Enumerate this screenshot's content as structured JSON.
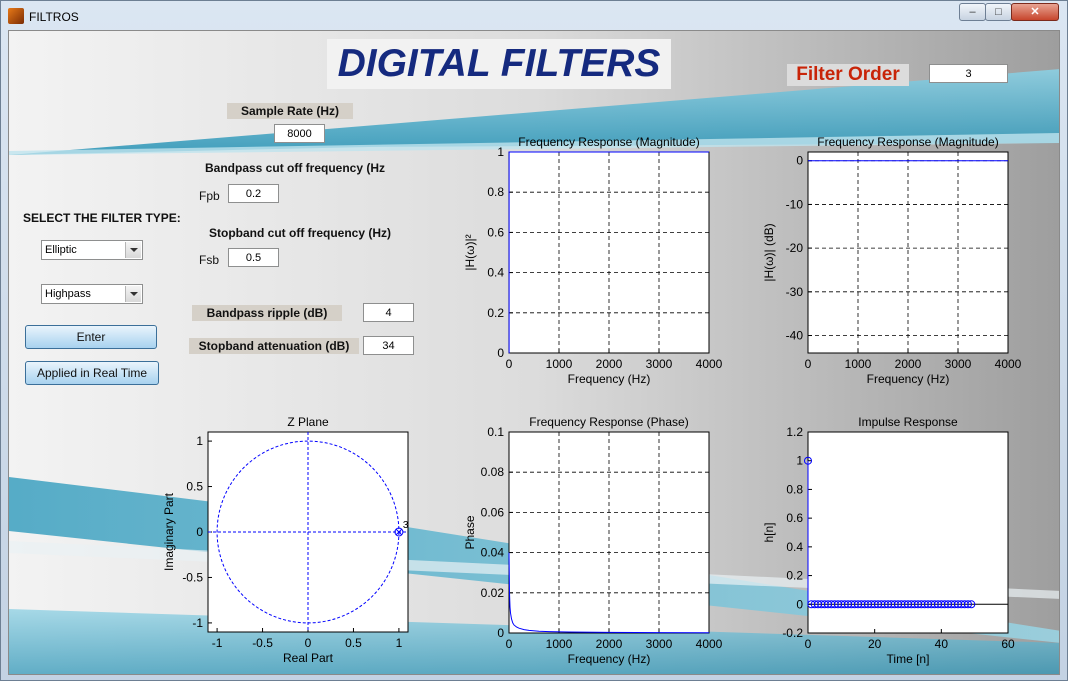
{
  "window": {
    "title": "FILTROS",
    "controls": {
      "minimize": "–",
      "maximize": "□",
      "close": "✕"
    }
  },
  "header": {
    "title": "DIGITAL FILTERS"
  },
  "filter_order": {
    "label": "Filter Order",
    "value": "3"
  },
  "sample_rate": {
    "label": "Sample Rate (Hz)",
    "value": "8000"
  },
  "bandpass_cutoff": {
    "label": "Bandpass cut off frequency (Hz",
    "short": "Fpb",
    "value": "0.2"
  },
  "stopband_cutoff": {
    "label": "Stopband cut off frequency (Hz)",
    "short": "Fsb",
    "value": "0.5"
  },
  "filter_type": {
    "label": "SELECT THE FILTER TYPE:",
    "design": "Elliptic",
    "response": "Highpass"
  },
  "buttons": {
    "enter": "Enter",
    "realtime": "Applied in Real Time"
  },
  "bandpass_ripple": {
    "label": "Bandpass ripple (dB)",
    "value": "4"
  },
  "stopband_attenuation": {
    "label": "Stopband attenuation (dB)",
    "value": "34"
  },
  "colors": {
    "accent_teal": "#3aa3c2",
    "trace": "#0000ff",
    "heading": "#152a7f",
    "order_label": "#c82408"
  },
  "chart_data": [
    {
      "id": "mag-linear",
      "type": "line",
      "title": "Frequency Response (Magnitude)",
      "xlabel": "Frequency (Hz)",
      "ylabel": "|H(ω)|²",
      "xlim": [
        0,
        4000
      ],
      "ylim": [
        0,
        1
      ],
      "xticks": [
        0,
        1000,
        2000,
        3000,
        4000
      ],
      "yticks": [
        0,
        0.2,
        0.4,
        0.6,
        0.8,
        1
      ],
      "grid": true,
      "series": [
        {
          "x": [
            0,
            2,
            2,
            4000
          ],
          "y": [
            0,
            0,
            1,
            1
          ]
        }
      ]
    },
    {
      "id": "mag-db",
      "type": "line",
      "title": "Frequency Response (Magnitude)",
      "xlabel": "Frequency (Hz)",
      "ylabel": "|H(ω)| (dB)",
      "xlim": [
        0,
        4000
      ],
      "ylim": [
        -44,
        2
      ],
      "xticks": [
        0,
        1000,
        2000,
        3000,
        4000
      ],
      "yticks": [
        0,
        -10,
        -20,
        -30,
        -40
      ],
      "grid": true,
      "series": [
        {
          "x": [
            0,
            4000
          ],
          "y": [
            0,
            0
          ]
        }
      ]
    },
    {
      "id": "zplane",
      "type": "scatter",
      "title": "Z Plane",
      "xlabel": "Real Part",
      "ylabel": "Imaginary Part",
      "xlim": [
        -1.1,
        1.1
      ],
      "ylim": [
        -1.1,
        1.1
      ],
      "xticks": [
        -1,
        -0.5,
        0,
        0.5,
        1
      ],
      "yticks": [
        -1,
        -0.5,
        0,
        0.5,
        1
      ],
      "grid": false,
      "unit_circle": true,
      "zeros": [
        {
          "x": 1,
          "y": 0,
          "multiplicity": "3"
        }
      ],
      "poles": [
        {
          "x": 1,
          "y": 0
        }
      ]
    },
    {
      "id": "phase",
      "type": "line",
      "title": "Frequency Response (Phase)",
      "xlabel": "Frequency (Hz)",
      "ylabel": "Phase",
      "xlim": [
        0,
        4000
      ],
      "ylim": [
        0,
        0.1
      ],
      "xticks": [
        0,
        1000,
        2000,
        3000,
        4000
      ],
      "yticks": [
        0,
        0.02,
        0.04,
        0.06,
        0.08,
        0.1
      ],
      "grid": true,
      "series": [
        {
          "x": [
            0,
            5,
            10,
            20,
            30,
            50,
            75,
            100,
            150,
            200,
            300,
            400,
            600,
            800,
            1200,
            2000,
            3000,
            4000
          ],
          "y": [
            0.04,
            0.03,
            0.02,
            0.013,
            0.01,
            0.007,
            0.005,
            0.004,
            0.003,
            0.0024,
            0.0017,
            0.0013,
            0.0009,
            0.0007,
            0.0005,
            0.0003,
            0.0002,
            0.0001
          ]
        }
      ]
    },
    {
      "id": "impulse",
      "type": "scatter",
      "title": "Impulse Response",
      "xlabel": "Time [n]",
      "ylabel": "h[n]",
      "xlim": [
        0,
        60
      ],
      "ylim": [
        -0.2,
        1.2
      ],
      "xticks": [
        0,
        20,
        40,
        60
      ],
      "yticks": [
        -0.2,
        0,
        0.2,
        0.4,
        0.6,
        0.8,
        1,
        1.2
      ],
      "grid": false,
      "stem": true,
      "series": [
        {
          "x": [
            0,
            1,
            2,
            3,
            4,
            5,
            6,
            7,
            8,
            9,
            10,
            11,
            12,
            13,
            14,
            15,
            16,
            17,
            18,
            19,
            20,
            21,
            22,
            23,
            24,
            25,
            26,
            27,
            28,
            29,
            30,
            31,
            32,
            33,
            34,
            35,
            36,
            37,
            38,
            39,
            40,
            41,
            42,
            43,
            44,
            45,
            46,
            47,
            48,
            49
          ],
          "y": [
            1,
            0,
            0,
            0,
            0,
            0,
            0,
            0,
            0,
            0,
            0,
            0,
            0,
            0,
            0,
            0,
            0,
            0,
            0,
            0,
            0,
            0,
            0,
            0,
            0,
            0,
            0,
            0,
            0,
            0,
            0,
            0,
            0,
            0,
            0,
            0,
            0,
            0,
            0,
            0,
            0,
            0,
            0,
            0,
            0,
            0,
            0,
            0,
            0,
            0
          ]
        }
      ]
    }
  ]
}
